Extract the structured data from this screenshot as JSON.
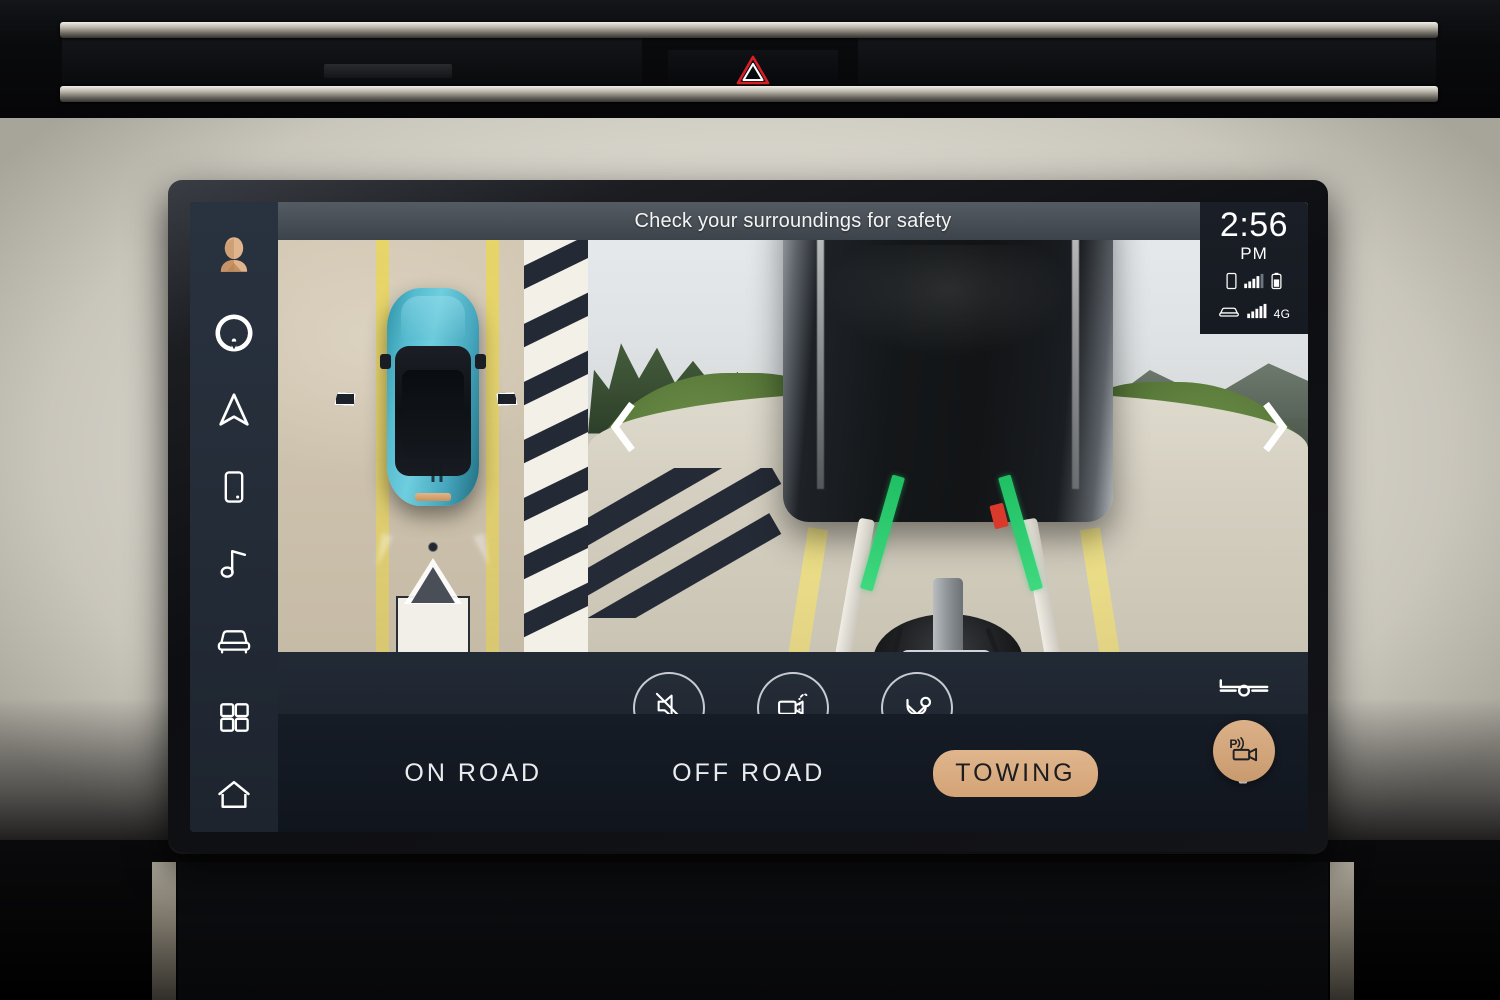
{
  "vehicle_dashboard": {
    "hazard_button": "hazard-warning-triangle"
  },
  "screen": {
    "header": {
      "message": "Check your surroundings for safety"
    },
    "status": {
      "time": "2:56",
      "meridiem": "PM",
      "phone_icon": "phone-icon",
      "phone_signal_icon": "signal-bars-icon",
      "battery_icon": "battery-icon",
      "vehicle_icon": "car-icon",
      "vehicle_signal_icon": "signal-bars-icon",
      "network_label": "4G"
    },
    "sidebar": {
      "items": [
        {
          "name": "user-profile",
          "icon": "user-avatar-icon"
        },
        {
          "name": "assistant",
          "icon": "ring-circle-icon"
        },
        {
          "name": "navigation",
          "icon": "navigation-arrow-icon"
        },
        {
          "name": "phone-projection",
          "icon": "smartphone-icon"
        },
        {
          "name": "media",
          "icon": "music-note-icon"
        },
        {
          "name": "vehicle",
          "icon": "car-front-icon"
        },
        {
          "name": "apps",
          "icon": "grid-apps-icon"
        },
        {
          "name": "home",
          "icon": "home-icon"
        }
      ]
    },
    "camera": {
      "left_view": {
        "name": "top-down-surround-view",
        "vehicle_color": "#4fb3c9",
        "guideline_color": "#e9d662",
        "trailer_visible": true
      },
      "right_view": {
        "name": "rear-hitch-camera-view",
        "guideline_color": "#2ec96f",
        "lane_color": "#efe184",
        "prev_icon": "chevron-left-icon",
        "next_icon": "chevron-right-icon"
      }
    },
    "controls": [
      {
        "name": "mute-audio",
        "icon": "speaker-mute-icon"
      },
      {
        "name": "clean-camera",
        "icon": "camera-wash-icon"
      },
      {
        "name": "hitch-assist",
        "icon": "hitch-guide-icon"
      }
    ],
    "right_controls": [
      {
        "name": "trailer-view",
        "icon": "trailer-icon"
      },
      {
        "name": "park-assist-camera",
        "icon": "park-assist-camera-icon"
      }
    ],
    "mode_bar": {
      "modes": [
        {
          "label": "ON ROAD",
          "active": false
        },
        {
          "label": "OFF ROAD",
          "active": false
        },
        {
          "label": "TOWING",
          "active": true
        }
      ],
      "settings_icon": "gear-icon"
    },
    "colors": {
      "accent_tan": "#d4a376",
      "screen_bg": "#161b24",
      "sidebar_bg": "#242c38",
      "header_band": "#474d54",
      "guide_green": "#2ec96f",
      "hazard_red": "#d81f26"
    }
  }
}
